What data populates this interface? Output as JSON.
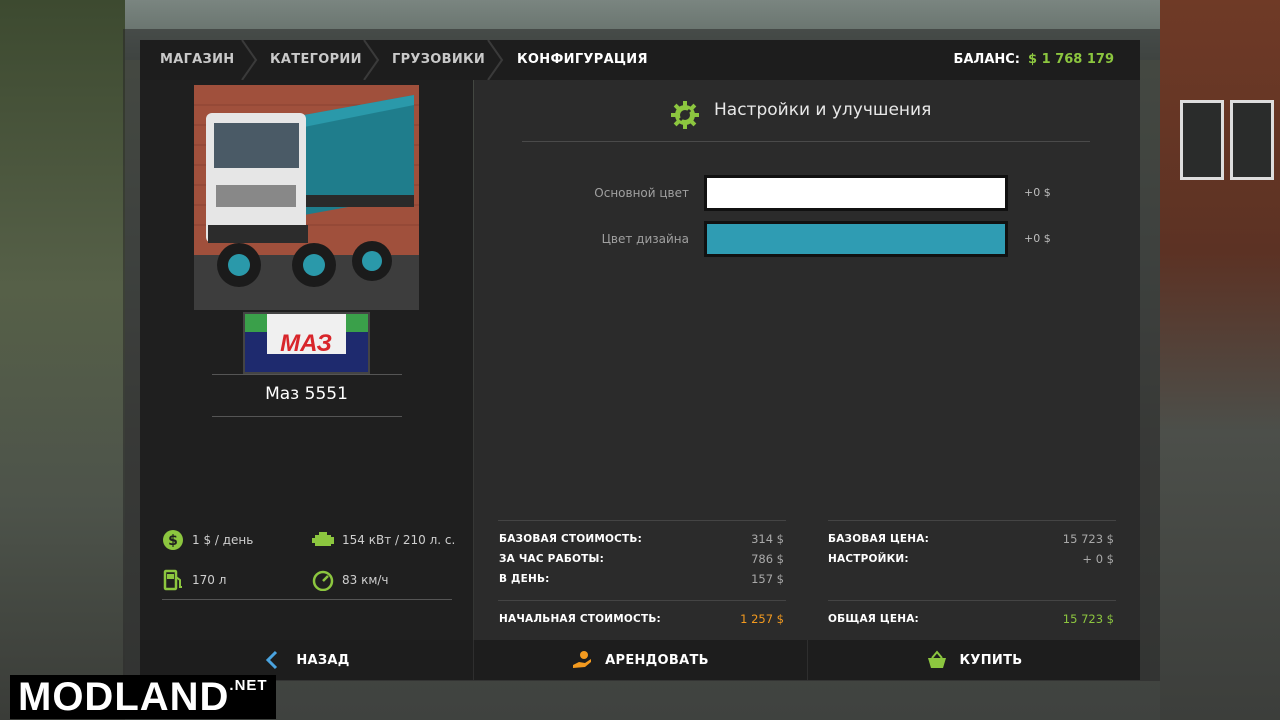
{
  "breadcrumb": [
    "МАГАЗИН",
    "КАТЕГОРИИ",
    "ГРУЗОВИКИ",
    "КОНФИГУРАЦИЯ"
  ],
  "balance": {
    "label": "БАЛАНС:",
    "value": "$ 1 768 179"
  },
  "vehicle": {
    "name": "Маз 5551",
    "brand_logo_text": "МАЗ",
    "specs": {
      "cost_per_day": "1 $ / день",
      "power": "154 кВт / 210 л. с.",
      "fuel": "170 л",
      "speed": "83 км/ч"
    }
  },
  "config": {
    "title": "Настройки и улучшения",
    "rows": [
      {
        "label": "Основной цвет",
        "price": "+0 $",
        "color": "#ffffff"
      },
      {
        "label": "Цвет дизайна",
        "price": "+0 $",
        "color": "#2f9cb3"
      }
    ]
  },
  "costs": {
    "lease": {
      "base_label": "БАЗОВАЯ СТОИМОСТЬ:",
      "base_value": "314 $",
      "hour_label": "ЗА ЧАС РАБОТЫ:",
      "hour_value": "786 $",
      "day_label": "В ДЕНЬ:",
      "day_value": "157 $",
      "initial_label": "НАЧАЛЬНАЯ СТОИМОСТЬ:",
      "initial_value": "1 257 $"
    },
    "buy": {
      "base_label": "БАЗОВАЯ ЦЕНА:",
      "base_value": "15 723 $",
      "settings_label": "НАСТРОЙКИ:",
      "settings_value": "+ 0 $",
      "total_label": "ОБЩАЯ ЦЕНА:",
      "total_value": "15 723 $"
    }
  },
  "buttons": {
    "back": "НАЗАД",
    "lease": "АРЕНДОВАТЬ",
    "buy": "КУПИТЬ"
  },
  "watermark": {
    "text": "MODLAND",
    "suffix": ".NET"
  },
  "colors": {
    "accent": "#8cc63f",
    "orange": "#f39a1f",
    "panel": "#1f1f1f"
  }
}
